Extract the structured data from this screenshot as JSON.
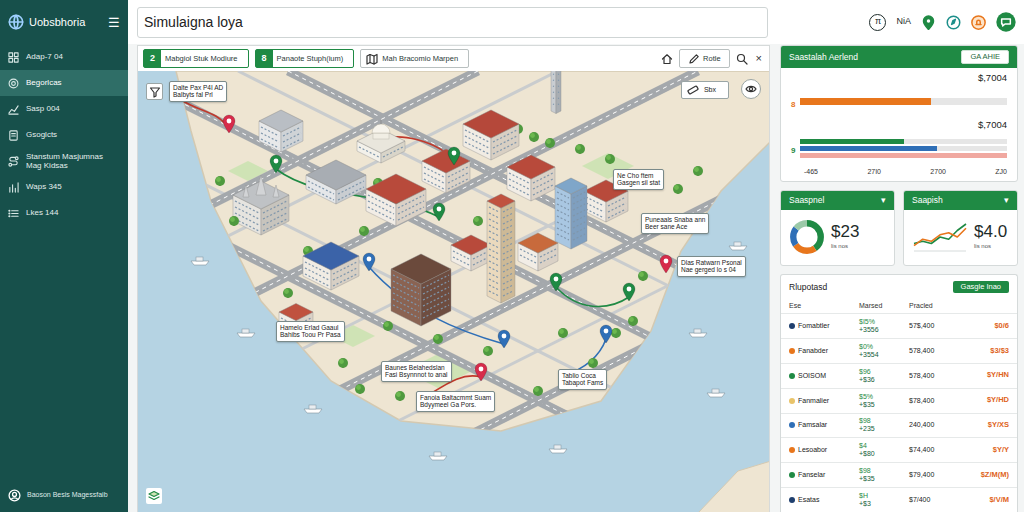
{
  "app": {
    "logo": "Uobsbhoria",
    "menu_icon": "☰"
  },
  "sidebar": {
    "items": [
      {
        "label": "Adap-7 04",
        "selected": false
      },
      {
        "label": "Begorlcas",
        "selected": true
      },
      {
        "label": "Sasp 004",
        "selected": false
      },
      {
        "label": "Gsoglcts",
        "selected": false
      },
      {
        "label": "Stanstum Masjumnas Mag Kidsas",
        "selected": false
      },
      {
        "label": "Waps 345",
        "selected": false
      },
      {
        "label": "Lkes 144",
        "selected": false
      }
    ],
    "footer": "Baoson Besis Magessfaib"
  },
  "topbar": {
    "search_value": "Simulaigna loya",
    "avatar": "π",
    "user": "NiA"
  },
  "map_toolbar": {
    "tabs": [
      {
        "badge": "2",
        "label": "Mabgiol Stuk Modiure",
        "active": true
      },
      {
        "badge": "8",
        "label": "Panaote Stuph(ium)",
        "active": true
      },
      {
        "label": "Mah Bracomio Marpen",
        "active": false
      }
    ],
    "edit": "Rotle",
    "close": "×"
  },
  "map": {
    "control": "Sbx",
    "pins": [
      {
        "color": "#d62b4a"
      },
      {
        "color": "#d62b4a"
      },
      {
        "color": "#d62b4a"
      },
      {
        "color": "#1f8a44"
      },
      {
        "color": "#1f8a44"
      },
      {
        "color": "#1f8a44"
      },
      {
        "color": "#1f8a44"
      },
      {
        "color": "#1f8a44"
      },
      {
        "color": "#2f6fb7"
      },
      {
        "color": "#2f6fb7"
      },
      {
        "color": "#2f6fb7"
      }
    ],
    "labels": [
      {
        "lines": [
          "Dalte Pax P4I AD",
          "Balbyts fal Prl"
        ]
      },
      {
        "lines": [
          "Ne Cho ftem",
          "Gasgen sil stat"
        ]
      },
      {
        "lines": [
          "Puneaals Snaba ann",
          "Beer sane Ace"
        ]
      },
      {
        "lines": [
          "Dlas Ratwarn Psonal",
          "Nae gerged lo s 04"
        ]
      },
      {
        "lines": [
          "Hamelo Erlad Gaaul",
          "Bahibs Toou Pr Pasa"
        ]
      },
      {
        "lines": [
          "Baunes Belahedslan",
          "Fasi Bsynnnot to anal"
        ]
      },
      {
        "lines": [
          "Fanoia Baltacmmt Suam",
          "Bdyymeel Ga Pors."
        ]
      },
      {
        "lines": [
          "Tablio Coca",
          "Tabapot Fams"
        ]
      }
    ]
  },
  "summary": {
    "title": "Saastalah Aerlend",
    "button": "GA AHIE",
    "max": 100,
    "groups": [
      {
        "amount": "$,7004",
        "label": "8",
        "color": "#e8761c",
        "bars": [
          {
            "value": 63,
            "color": "#e8761c"
          }
        ]
      },
      {
        "amount": "$,7004",
        "label": "9",
        "color": "#1f8a44",
        "bars": [
          {
            "value": 50,
            "color": "#1f8a44"
          },
          {
            "value": 66,
            "color": "#2f6fb7"
          },
          {
            "value": 100,
            "color": "#f0a8a0"
          }
        ]
      }
    ],
    "ticks": [
      "-465",
      "27I0",
      "2700",
      "ZJ0"
    ]
  },
  "stats": [
    {
      "title": "Saaspnel",
      "caret": "▾",
      "value": "$23",
      "sub": "lis nos",
      "kind": "gauge",
      "segments": [
        {
          "value": 40,
          "color": "#1f8a44"
        },
        {
          "value": 25,
          "color": "#e8761c"
        },
        {
          "value": 20,
          "color": "#2f6fb7"
        },
        {
          "value": 15,
          "color": "#9bc9a8"
        }
      ]
    },
    {
      "title": "Saapish",
      "caret": "▾",
      "value": "$4.0",
      "sub": "lis nos",
      "kind": "line",
      "series": [
        {
          "color": "#1f8a44",
          "values": [
            3,
            4,
            3,
            6,
            5,
            9,
            12
          ]
        },
        {
          "color": "#e8761c",
          "values": [
            2,
            5,
            4,
            7,
            8,
            6,
            10
          ]
        }
      ]
    }
  ],
  "report": {
    "title": "Rlupotasd",
    "button": "Gasgle Inao",
    "columns": [
      "Ese",
      "Marsed",
      "Pracled"
    ],
    "rows": [
      {
        "name": "Fomabtler",
        "color": "#1f3f6e",
        "marsed": [
          "$I5%",
          "+3556"
        ],
        "pracled": "57$,400",
        "change": "$0/6"
      },
      {
        "name": "Fanabder",
        "color": "#e8761c",
        "marsed": [
          "$0%",
          "+3554"
        ],
        "pracled": "578,400",
        "change": "$3/$3"
      },
      {
        "name": "SOISOM",
        "color": "#1f8a44",
        "marsed": [
          "$96",
          "+$36"
        ],
        "pracled": "578,400",
        "change": "$Y/HN"
      },
      {
        "name": "Fanmalier",
        "color": "#e9c46a",
        "marsed": [
          "$5%",
          "+$35"
        ],
        "pracled": "$78,400",
        "change": "$Y/HD"
      },
      {
        "name": "Famsalar",
        "color": "#2f6fb7",
        "marsed": [
          "$98",
          "+235"
        ],
        "pracled": "240,400",
        "change": "$Y/XS"
      },
      {
        "name": "Lesoabor",
        "color": "#e8761c",
        "marsed": [
          "$4",
          "+$80"
        ],
        "pracled": "$74,400",
        "change": "$Y/Y"
      },
      {
        "name": "Fanselar",
        "color": "#1f8a44",
        "marsed": [
          "$98",
          "+$35"
        ],
        "pracled": "$79,400",
        "change": "$Z/M(M)"
      },
      {
        "name": "Esatas",
        "color": "#1f3f6e",
        "marsed": [
          "$H",
          "+$3"
        ],
        "pracled": "$7/400",
        "change": "$/V/M"
      }
    ]
  }
}
